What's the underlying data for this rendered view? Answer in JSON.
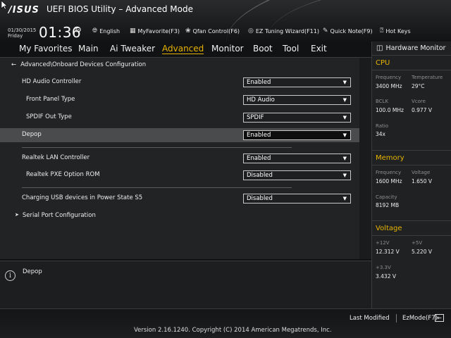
{
  "header": {
    "logo": "/ISUS",
    "title": "UEFI BIOS Utility – Advanced Mode",
    "date": "01/30/2015",
    "day": "Friday",
    "time": "01:36",
    "tools": [
      {
        "icon": "globe-icon",
        "label": "English"
      },
      {
        "icon": "myfavorite-icon",
        "label": "MyFavorite(F3)"
      },
      {
        "icon": "fan-icon",
        "label": "Qfan Control(F6)"
      },
      {
        "icon": "bulb-icon",
        "label": "EZ Tuning Wizard(F11)"
      },
      {
        "icon": "note-icon",
        "label": "Quick Note(F9)"
      },
      {
        "icon": "question-icon",
        "label": "Hot Keys"
      }
    ]
  },
  "menu": {
    "items": [
      "My Favorites",
      "Main",
      "Ai Tweaker",
      "Advanced",
      "Monitor",
      "Boot",
      "Tool",
      "Exit"
    ],
    "active": "Advanced"
  },
  "main": {
    "breadcrumb": "Advanced\\Onboard Devices Configuration",
    "rows": [
      {
        "label": "HD Audio Controller",
        "value": "Enabled"
      },
      {
        "label": "Front Panel Type",
        "value": "HD Audio"
      },
      {
        "label": "SPDIF Out Type",
        "value": "SPDIF"
      },
      {
        "label": "Depop",
        "value": "Enabled"
      },
      {
        "label": "Realtek LAN Controller",
        "value": "Enabled"
      },
      {
        "label": "Realtek PXE Option ROM",
        "value": "Disabled"
      },
      {
        "label": "Charging USB devices in Power State S5",
        "value": "Disabled"
      },
      {
        "label": "Serial Port Configuration"
      }
    ],
    "help_text": "Depop"
  },
  "hwmon": {
    "title": "Hardware Monitor",
    "cpu": {
      "heading": "CPU",
      "frequency_label": "Frequency",
      "frequency": "3400 MHz",
      "temperature_label": "Temperature",
      "temperature": "29°C",
      "bclk_label": "BCLK",
      "bclk": "100.0 MHz",
      "vcore_label": "Vcore",
      "vcore": "0.977 V",
      "ratio_label": "Ratio",
      "ratio": "34x"
    },
    "memory": {
      "heading": "Memory",
      "frequency_label": "Frequency",
      "frequency": "1600 MHz",
      "voltage_label": "Voltage",
      "voltage": "1.650 V",
      "capacity_label": "Capacity",
      "capacity": "8192 MB"
    },
    "voltage": {
      "heading": "Voltage",
      "v12_label": "+12V",
      "v12": "12.312 V",
      "v5_label": "+5V",
      "v5": "5.220 V",
      "v33_label": "+3.3V",
      "v33": "3.432 V"
    }
  },
  "footer": {
    "last_modified": "Last Modified",
    "ezmode": "EzMode(F7)",
    "version": "Version 2.16.1240. Copyright (C) 2014 American Megatrends, Inc."
  },
  "colors": {
    "accent": "#e8b400",
    "background": "#1b1c1e",
    "highlight_row": "#4a4b4d"
  }
}
